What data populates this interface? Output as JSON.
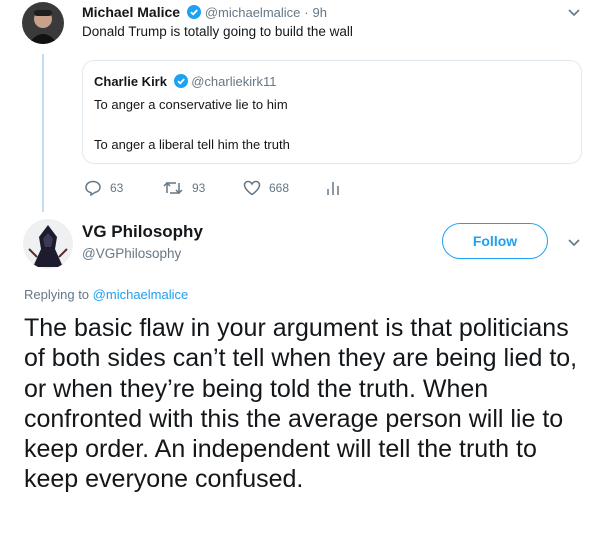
{
  "original_tweet": {
    "author_name": "Michael Malice",
    "handle": "@michaelmalice",
    "separator": "·",
    "time": "9h",
    "text": "Donald Trump is totally going to build the wall"
  },
  "quoted_tweet": {
    "author_name": "Charlie Kirk",
    "handle": "@charliekirk11",
    "line1": "To anger a conservative lie to him",
    "line2": "To anger a liberal tell him the truth"
  },
  "actions": {
    "replies": "63",
    "retweets": "93",
    "likes": "668"
  },
  "reply_tweet": {
    "author_name": "VG Philosophy",
    "handle": "@VGPhilosophy",
    "follow_label": "Follow",
    "replying_to_label": "Replying to",
    "replying_to_handle": "@michaelmalice",
    "text": "The basic flaw in your argument is that politicians of both sides can’t tell when they are being lied to, or when they’re being told the truth. When confronted with this the average person will lie to keep order. An independent will tell the truth to keep everyone confused."
  },
  "colors": {
    "accent": "#1da1f2",
    "muted": "#657786",
    "thread_line": "#c4dcef",
    "border": "#e1e8ed"
  },
  "icons": [
    "reply-icon",
    "retweet-icon",
    "like-icon",
    "analytics-icon",
    "verified-icon",
    "chevron-down-icon"
  ]
}
